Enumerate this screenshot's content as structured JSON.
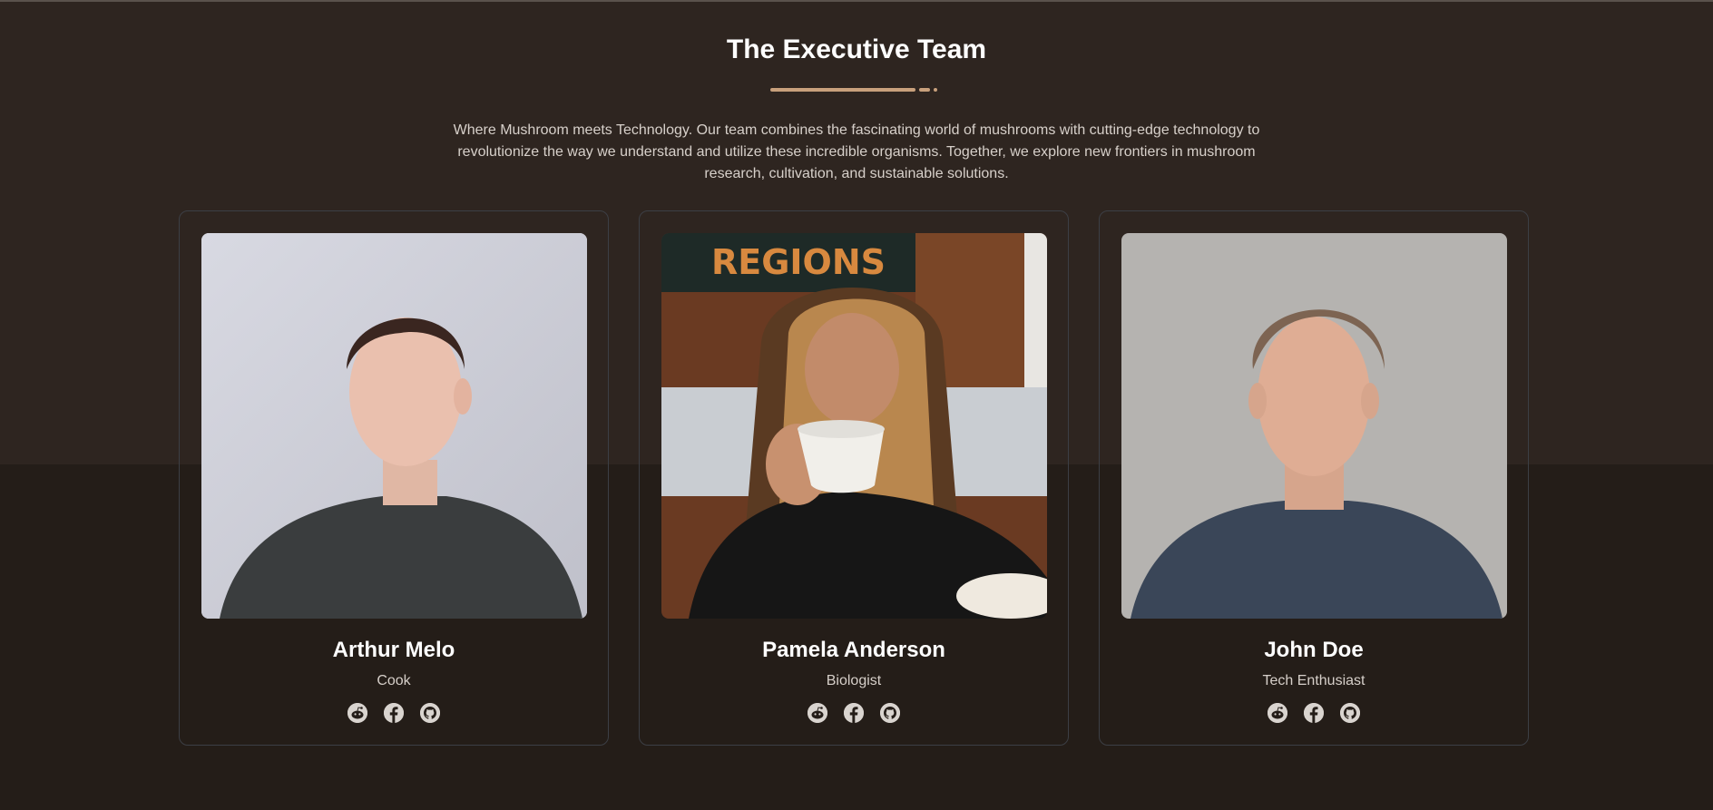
{
  "section": {
    "title": "The Executive Team",
    "intro": "Where Mushroom meets Technology. Our team combines the fascinating world of mushrooms with cutting-edge technology to revolutionize the way we understand and utilize these incredible organisms. Together, we explore new frontiers in mushroom research, cultivation, and sustainable solutions."
  },
  "colors": {
    "background_top": "#2e2520",
    "background_bottom": "#241d18",
    "accent": "#c8a07c",
    "card_border": "#3c3f45",
    "heading": "#ffffff",
    "body_text": "#d7d0ca"
  },
  "team": [
    {
      "name": "Arthur Melo",
      "role": "Cook",
      "photo_icon": "portrait-man-dark-shirt",
      "socials": [
        "reddit-icon",
        "facebook-icon",
        "github-icon"
      ]
    },
    {
      "name": "Pamela Anderson",
      "role": "Biologist",
      "photo_icon": "portrait-woman-coffee-cup",
      "socials": [
        "reddit-icon",
        "facebook-icon",
        "github-icon"
      ]
    },
    {
      "name": "John Doe",
      "role": "Tech Enthusiast",
      "photo_icon": "portrait-man-navy-shirt",
      "socials": [
        "reddit-icon",
        "facebook-icon",
        "github-icon"
      ]
    }
  ]
}
